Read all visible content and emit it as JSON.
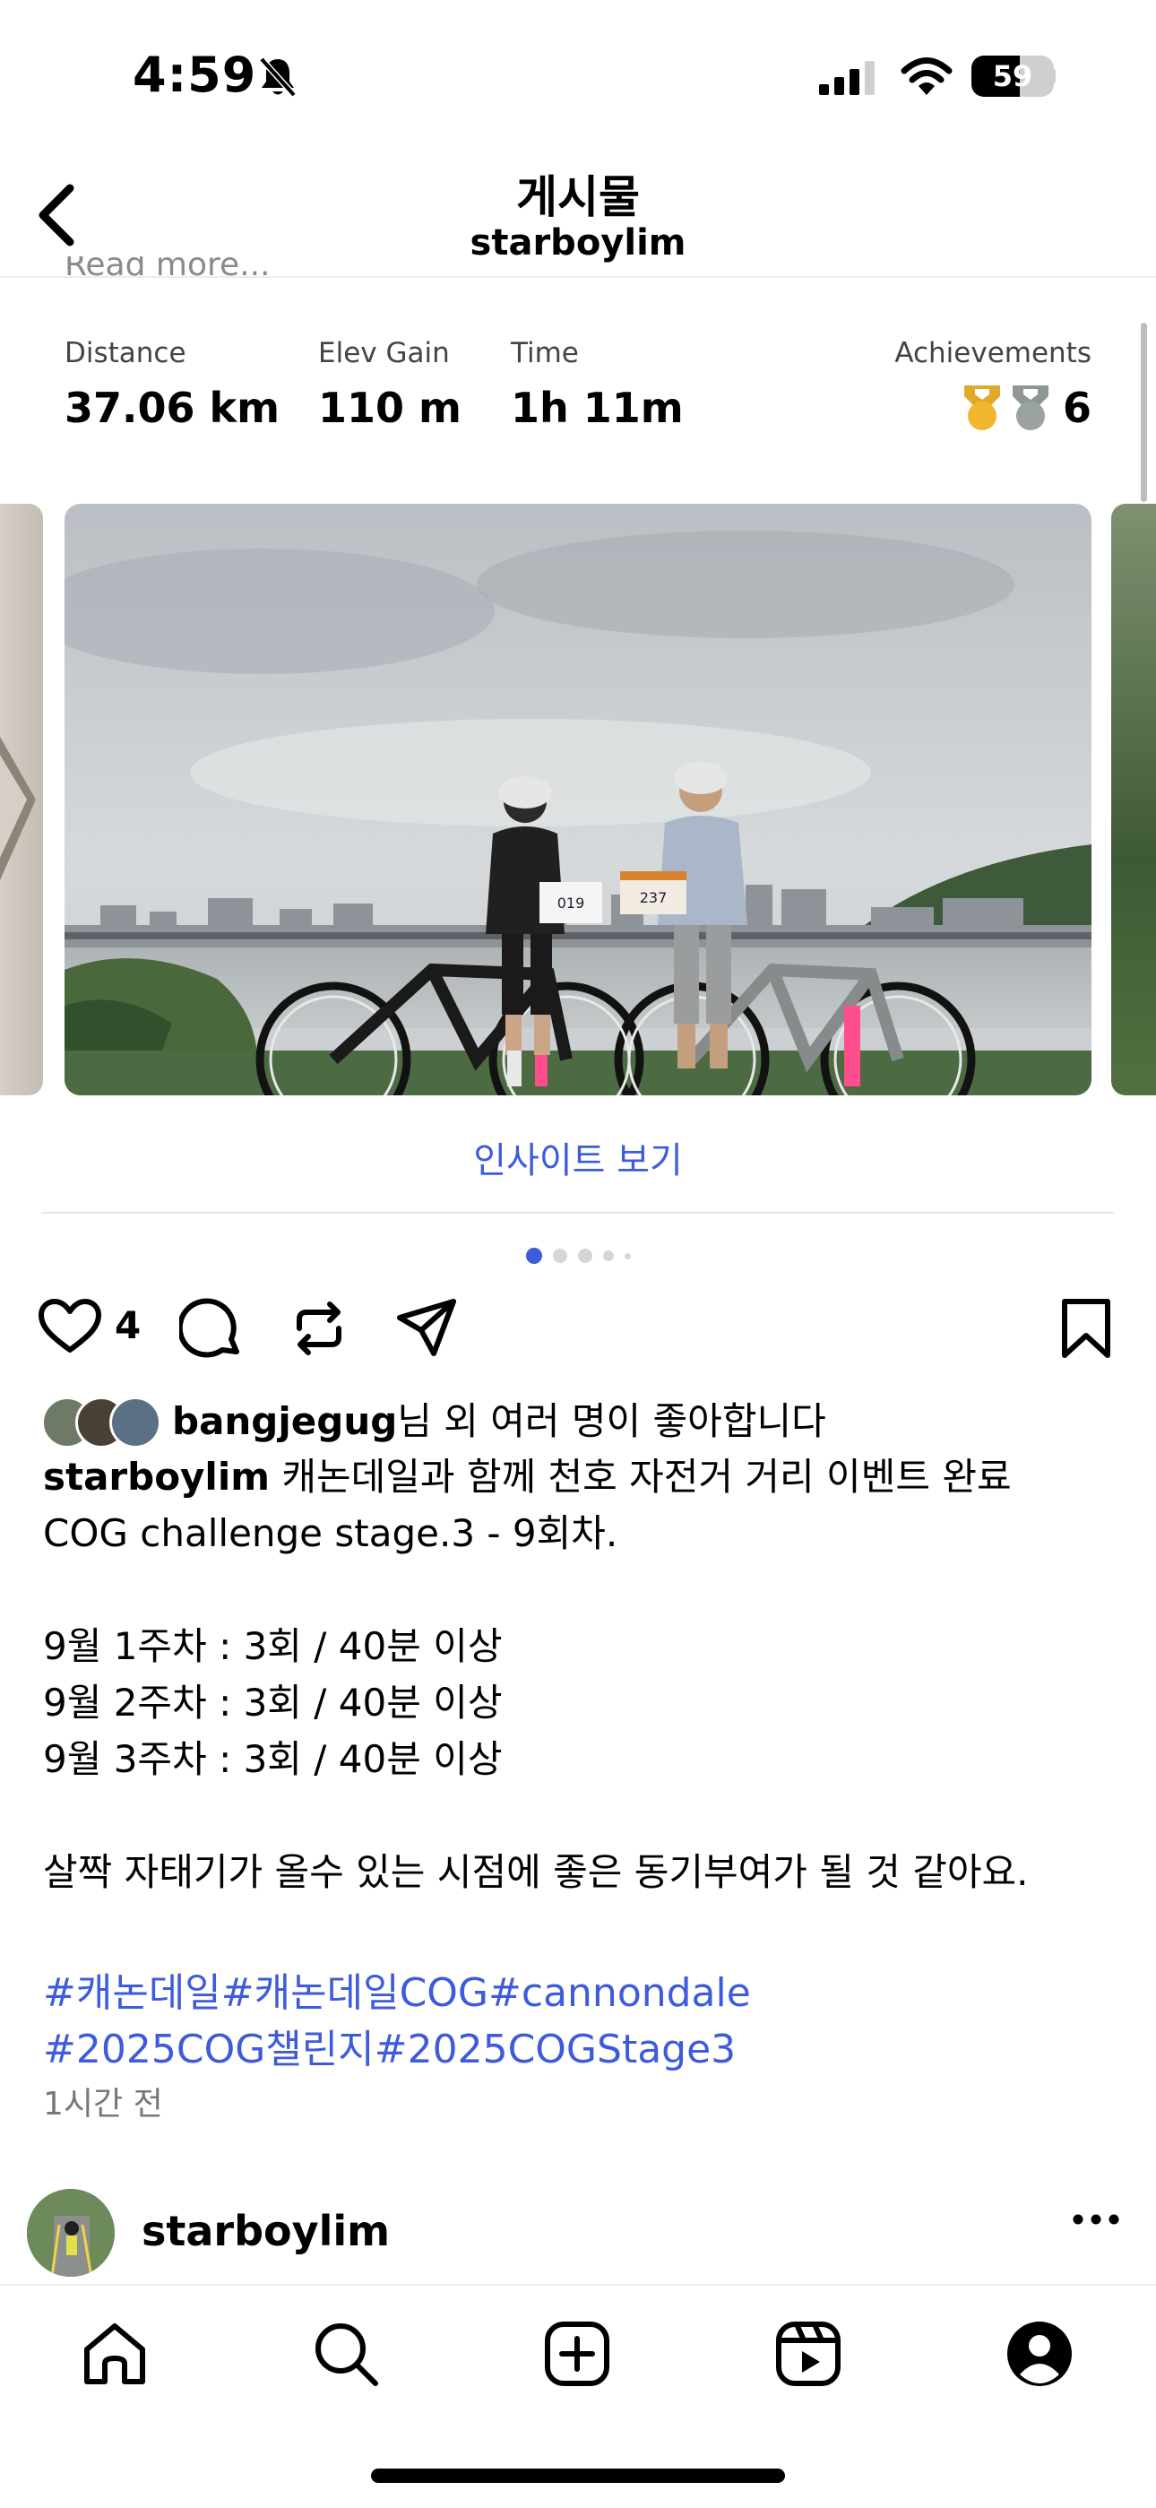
{
  "status_bar": {
    "time": "4:59",
    "battery": "59",
    "battery_level": 0.59
  },
  "header": {
    "title": "게시물",
    "subtitle": "starboylim",
    "cut_text": "Read more..."
  },
  "stats": {
    "distance_label": "Distance",
    "distance_value": "37.06 km",
    "elev_label": "Elev Gain",
    "elev_value": "110 m",
    "time_label": "Time",
    "time_value": "1h 11m",
    "achievements_label": "Achievements",
    "achievements_count": "6"
  },
  "photo": {
    "bib_left": "019",
    "bib_right": "237"
  },
  "insights": {
    "label": "인사이트 보기"
  },
  "carousel": {
    "total": 5,
    "active": 0
  },
  "actions": {
    "like_count": "4"
  },
  "likes": {
    "user": "bangjegug",
    "suffix": "님 외 여러 명이 좋아합니다"
  },
  "caption": {
    "user": "starboylim",
    "text": " 캐논데일과 함께 천호 자전거 거리 이벤트 완료\nCOG challenge stage.3 - 9회차.\n\n9월 1주차 : 3회 / 40분 이상\n9월 2주차 : 3회 / 40분 이상\n9월 3주차 : 3회 / 40분 이상\n\n살짝 자태기가 올수 있는 시점에 좋은 동기부여가 될 것 같아요."
  },
  "hashtags": {
    "line1": "#캐논데일#캐논데일COG#cannondale",
    "line2": "#2025COG챌린지#2025COGStage3"
  },
  "post_time": "1시간 전",
  "next_post": {
    "user": "starboylim"
  },
  "colors": {
    "link": "#3e5bdb",
    "active_dot": "#3e5bdb"
  },
  "tabs": [
    "home-icon",
    "search-icon",
    "create-icon",
    "reels-icon",
    "profile-icon"
  ]
}
